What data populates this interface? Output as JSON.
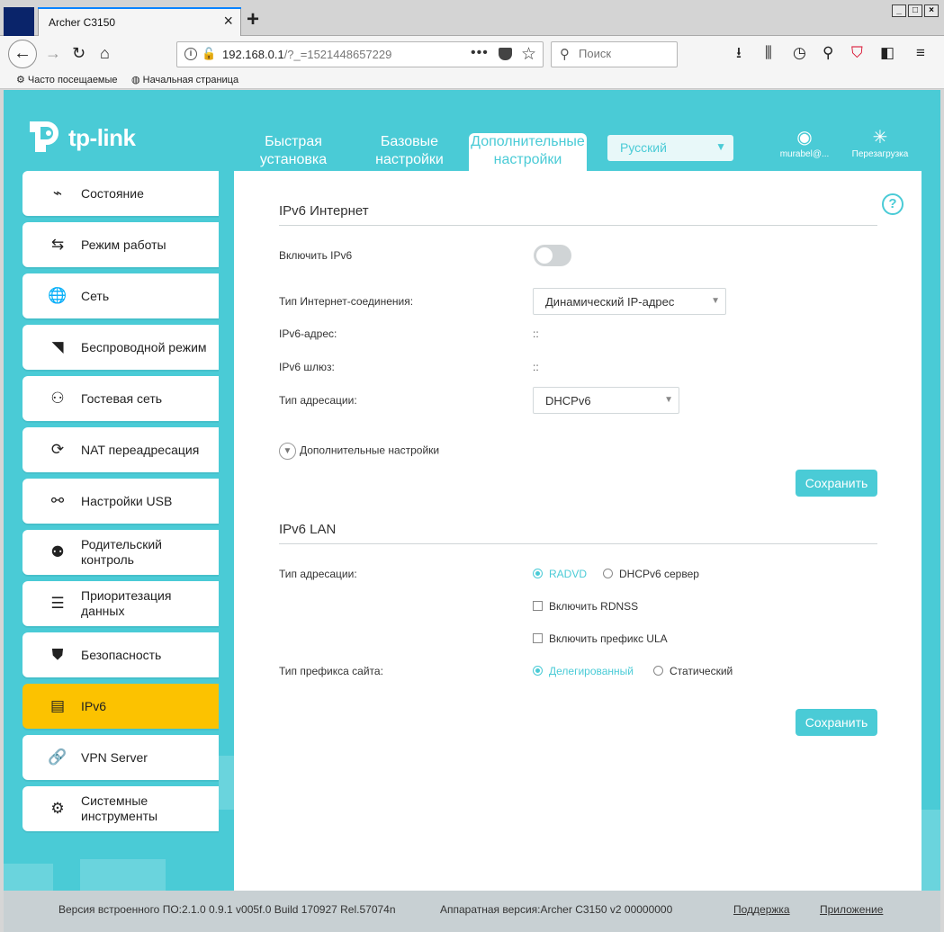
{
  "browser": {
    "tab_title": "Archer C3150",
    "url_host": "192.168.0.1",
    "url_path": "/?_=1521448657229",
    "search_placeholder": "Поиск",
    "bookmarks": [
      "Часто посещаемые",
      "Начальная страница"
    ]
  },
  "header": {
    "logo": "tp-link",
    "nav": [
      {
        "label": "Быстрая установка"
      },
      {
        "label": "Базовые настройки"
      },
      {
        "label": "Дополнительные настройки",
        "active": true
      }
    ],
    "language": "Русский",
    "user": "murabel@...",
    "reboot": "Перезагрузка"
  },
  "sidebar": {
    "items": [
      {
        "label": "Состояние",
        "icon": "pulse-icon"
      },
      {
        "label": "Режим работы",
        "icon": "swap-icon"
      },
      {
        "label": "Сеть",
        "icon": "globe-icon"
      },
      {
        "label": "Беспроводной режим",
        "icon": "wifi-icon"
      },
      {
        "label": "Гостевая сеть",
        "icon": "guests-icon"
      },
      {
        "label": "NAT переадресация",
        "icon": "nat-icon"
      },
      {
        "label": "Настройки USB",
        "icon": "usb-icon"
      },
      {
        "label": "Родительский контроль",
        "icon": "parental-icon"
      },
      {
        "label": "Приоритезация данных",
        "icon": "qos-icon"
      },
      {
        "label": "Безопасность",
        "icon": "shield-icon"
      },
      {
        "label": "IPv6",
        "icon": "ipv6-icon",
        "active": true
      },
      {
        "label": "VPN Server",
        "icon": "link-icon"
      },
      {
        "label": "Системные инструменты",
        "icon": "gear-icon"
      }
    ]
  },
  "internet": {
    "title": "IPv6 Интернет",
    "enable_label": "Включить IPv6",
    "enable_on": false,
    "conn_type_label": "Тип Интернет-соединения:",
    "conn_type_value": "Динамический IP-адрес",
    "addr_label": "IPv6-адрес:",
    "addr_value": "::",
    "gw_label": "IPv6 шлюз:",
    "gw_value": "::",
    "addressing_label": "Тип адресации:",
    "addressing_value": "DHCPv6",
    "advanced": "Дополнительные настройки",
    "save": "Сохранить"
  },
  "lan": {
    "title": "IPv6 LAN",
    "addressing_label": "Тип адресации:",
    "radio_radvd": "RADVD",
    "radio_dhcp": "DHCPv6 сервер",
    "chk_rdnss": "Включить RDNSS",
    "chk_ula": "Включить префикс ULA",
    "prefix_label": "Тип префикса сайта:",
    "radio_delegated": "Делегированный",
    "radio_static": "Статический",
    "save": "Сохранить"
  },
  "footer": {
    "firmware": "Версия встроенного ПО:2.1.0 0.9.1 v005f.0 Build 170927 Rel.57074n",
    "hardware": "Аппаратная версия:Archer C3150 v2 00000000",
    "support": "Поддержка",
    "app": "Приложение"
  },
  "colors": {
    "accent": "#4acbd6",
    "active_menu": "#fcc200"
  }
}
